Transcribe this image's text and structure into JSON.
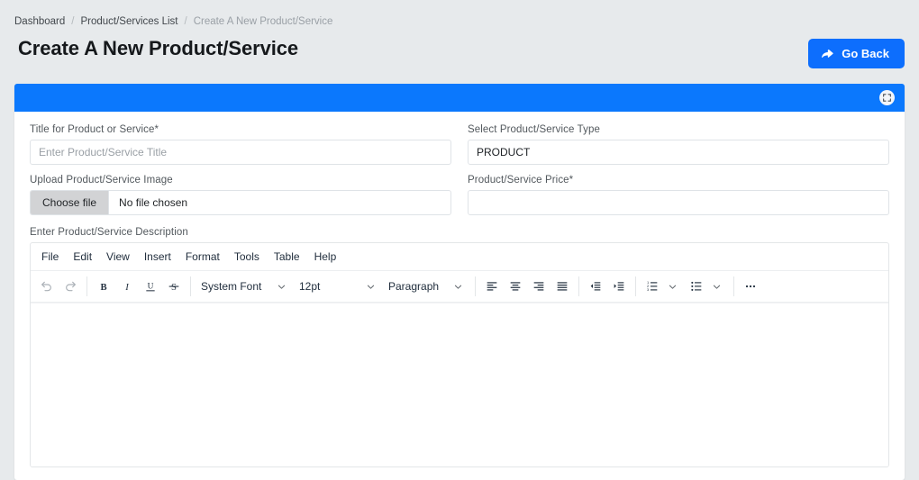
{
  "breadcrumb": {
    "items": [
      {
        "label": "Dashboard",
        "muted": false
      },
      {
        "label": "Product/Services List",
        "muted": false
      },
      {
        "label": "Create A New Product/Service",
        "muted": true
      }
    ],
    "separator": "/"
  },
  "header": {
    "title": "Create A New Product/Service",
    "go_back_label": "Go Back",
    "accent_color": "#0d6efd"
  },
  "card": {
    "banner_color": "#0b78fd",
    "fullscreen_icon": "fullscreen-expand-icon"
  },
  "form": {
    "title_field": {
      "label": "Title for Product or Service*",
      "value": "",
      "placeholder": "Enter Product/Service Title"
    },
    "type_field": {
      "label": "Select Product/Service Type",
      "value": "PRODUCT"
    },
    "image_field": {
      "label": "Upload Product/Service Image",
      "button_label": "Choose file",
      "file_status": "No file chosen"
    },
    "price_field": {
      "label": "Product/Service Price*",
      "value": "",
      "placeholder": ""
    }
  },
  "editor": {
    "label": "Enter Product/Service Description",
    "menus": [
      "File",
      "Edit",
      "View",
      "Insert",
      "Format",
      "Tools",
      "Table",
      "Help"
    ],
    "toolbar": {
      "undo": "undo-icon",
      "redo": "redo-icon",
      "bold": "B",
      "italic": "I",
      "underline": "U",
      "strikethrough": "S",
      "font_family": "System Font",
      "font_size": "12pt",
      "block_format": "Paragraph",
      "align_left": "align-left-icon",
      "align_center": "align-center-icon",
      "align_right": "align-right-icon",
      "align_justify": "align-justify-icon",
      "outdent": "outdent-icon",
      "indent": "indent-icon",
      "numbered_list": "numbered-list-icon",
      "bullet_list": "bullet-list-icon",
      "more": "…"
    },
    "content": ""
  }
}
